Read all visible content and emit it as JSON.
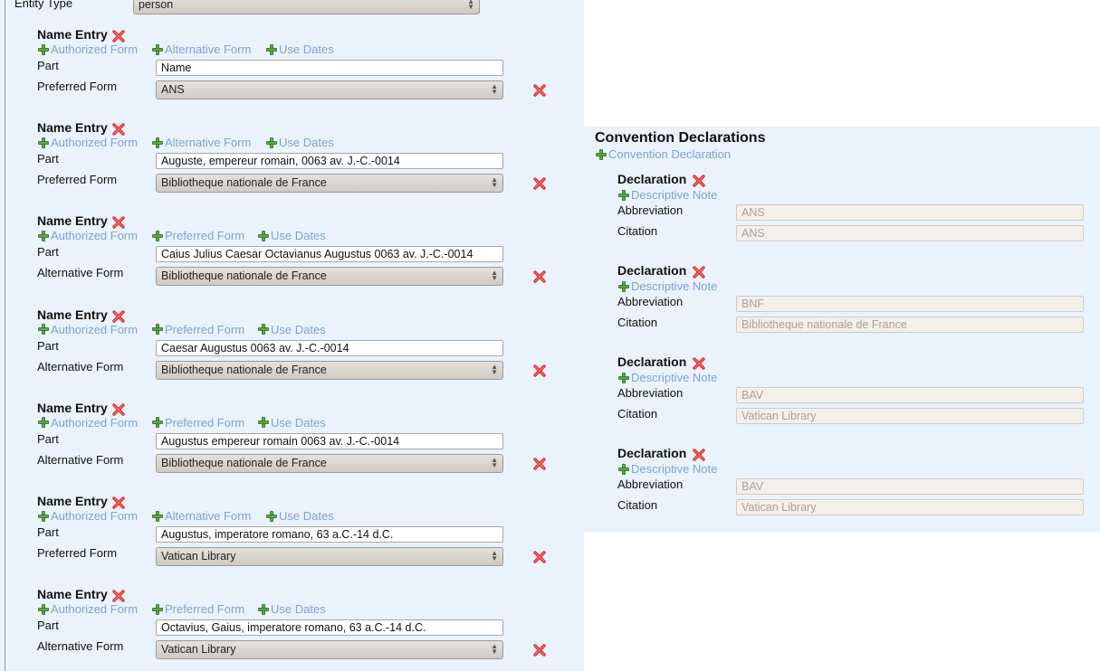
{
  "entity": {
    "label": "Entity Type",
    "value": "person"
  },
  "name_entries": [
    {
      "title": "Name Entry",
      "links": [
        "Authorized Form",
        "Alternative Form",
        "Use Dates"
      ],
      "part_label": "Part",
      "part": "Name",
      "form_label": "Preferred Form",
      "form_value": "ANS"
    },
    {
      "title": "Name Entry",
      "links": [
        "Authorized Form",
        "Alternative Form",
        "Use Dates"
      ],
      "part_label": "Part",
      "part": "Auguste, empereur romain, 0063 av. J.-C.-0014",
      "form_label": "Preferred Form",
      "form_value": "Bibliotheque nationale de France"
    },
    {
      "title": "Name Entry",
      "links": [
        "Authorized Form",
        "Preferred Form",
        "Use Dates"
      ],
      "part_label": "Part",
      "part": "Caius Julius Caesar Octavianus Augustus 0063 av. J.-C.-0014",
      "form_label": "Alternative Form",
      "form_value": "Bibliotheque nationale de France"
    },
    {
      "title": "Name Entry",
      "links": [
        "Authorized Form",
        "Preferred Form",
        "Use Dates"
      ],
      "part_label": "Part",
      "part": "Caesar Augustus 0063 av. J.-C.-0014",
      "form_label": "Alternative Form",
      "form_value": "Bibliotheque nationale de France"
    },
    {
      "title": "Name Entry",
      "links": [
        "Authorized Form",
        "Preferred Form",
        "Use Dates"
      ],
      "part_label": "Part",
      "part": "Augustus empereur romain 0063 av. J.-C.-0014",
      "form_label": "Alternative Form",
      "form_value": "Bibliotheque nationale de France"
    },
    {
      "title": "Name Entry",
      "links": [
        "Authorized Form",
        "Alternative Form",
        "Use Dates"
      ],
      "part_label": "Part",
      "part": "Augustus, imperatore romano, 63 a.C.-14 d.C.",
      "form_label": "Preferred Form",
      "form_value": "Vatican Library"
    },
    {
      "title": "Name Entry",
      "links": [
        "Authorized Form",
        "Preferred Form",
        "Use Dates"
      ],
      "part_label": "Part",
      "part": "Octavius, Gaius, imperatore romano, 63 a.C.-14 d.C.",
      "form_label": "Alternative Form",
      "form_value": "Vatican Library"
    }
  ],
  "conventions": {
    "title": "Convention Declarations",
    "add_label": "Convention Declaration",
    "declarations": [
      {
        "title": "Declaration",
        "note_label": "Descriptive Note",
        "abbr_label": "Abbreviation",
        "abbr": "ANS",
        "citation_label": "Citation",
        "citation": "ANS"
      },
      {
        "title": "Declaration",
        "note_label": "Descriptive Note",
        "abbr_label": "Abbreviation",
        "abbr": "BNF",
        "citation_label": "Citation",
        "citation": "Bibliotheque nationale de France"
      },
      {
        "title": "Declaration",
        "note_label": "Descriptive Note",
        "abbr_label": "Abbreviation",
        "abbr": "BAV",
        "citation_label": "Citation",
        "citation": "Vatican Library"
      },
      {
        "title": "Declaration",
        "note_label": "Descriptive Note",
        "abbr_label": "Abbreviation",
        "abbr": "BAV",
        "citation_label": "Citation",
        "citation": "Vatican Library"
      }
    ]
  },
  "colors": {
    "panel_bg": "#eaf2fb",
    "link": "#7da4d0",
    "delete": "#d9302c",
    "add": "#5fa74a"
  },
  "icons": {
    "delete": "red-x-icon",
    "add": "green-plus-icon",
    "select": "up-down-arrows-icon"
  }
}
